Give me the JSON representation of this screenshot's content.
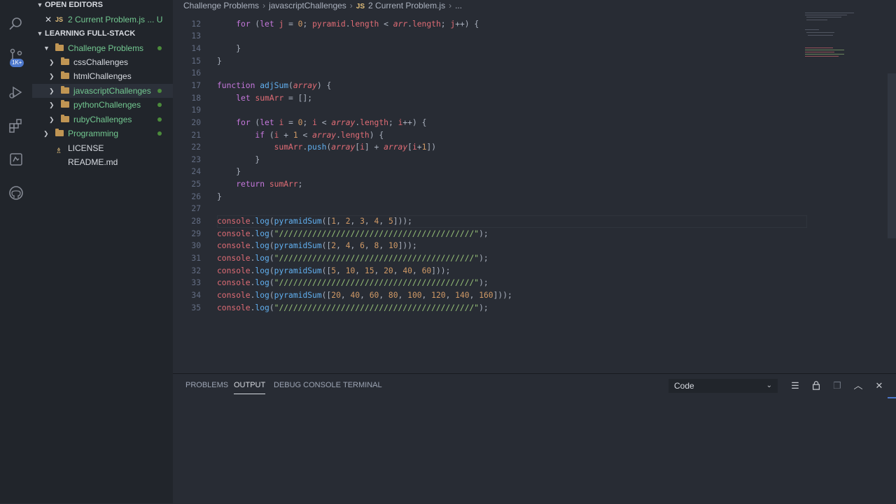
{
  "sidebar": {
    "open_editors_label": "OPEN EDITORS",
    "open_editor": {
      "lang": "JS",
      "name": "2 Current Problem.js ... U"
    },
    "workspace_label": "LEARNING FULL-STACK",
    "badge": "1K+",
    "tree": [
      {
        "label": "Challenge Problems",
        "type": "folder",
        "expanded": true
      },
      {
        "label": "cssChallenges",
        "type": "folder"
      },
      {
        "label": "htmlChallenges",
        "type": "folder"
      },
      {
        "label": "javascriptChallenges",
        "type": "folder",
        "selected": true
      },
      {
        "label": "pythonChallenges",
        "type": "folder"
      },
      {
        "label": "rubyChallenges",
        "type": "folder"
      },
      {
        "label": "Programming",
        "type": "folder"
      },
      {
        "label": "LICENSE",
        "type": "file"
      },
      {
        "label": "README.md",
        "type": "file"
      }
    ]
  },
  "breadcrumb": {
    "items": [
      "Challenge Problems",
      "javascriptChallenges"
    ],
    "file_lang": "JS",
    "file": "2 Current Problem.js",
    "more": "..."
  },
  "code": {
    "line_numbers": [
      "12",
      "13",
      "14",
      "15",
      "16",
      "17",
      "18",
      "19",
      "20",
      "21",
      "22",
      "23",
      "24",
      "25",
      "26",
      "27",
      "28",
      "29",
      "30",
      "31",
      "32",
      "33",
      "34",
      "35"
    ]
  },
  "panel": {
    "tabs": [
      "PROBLEMS",
      "OUTPUT",
      "DEBUG CONSOLE",
      "TERMINAL"
    ],
    "active_tab": "OUTPUT",
    "output_channel": "Code"
  },
  "colors": {
    "activity_bar": "#21252b",
    "editor_bg": "#282c34",
    "accent": "#4d78cc",
    "git_added": "#73c991"
  }
}
